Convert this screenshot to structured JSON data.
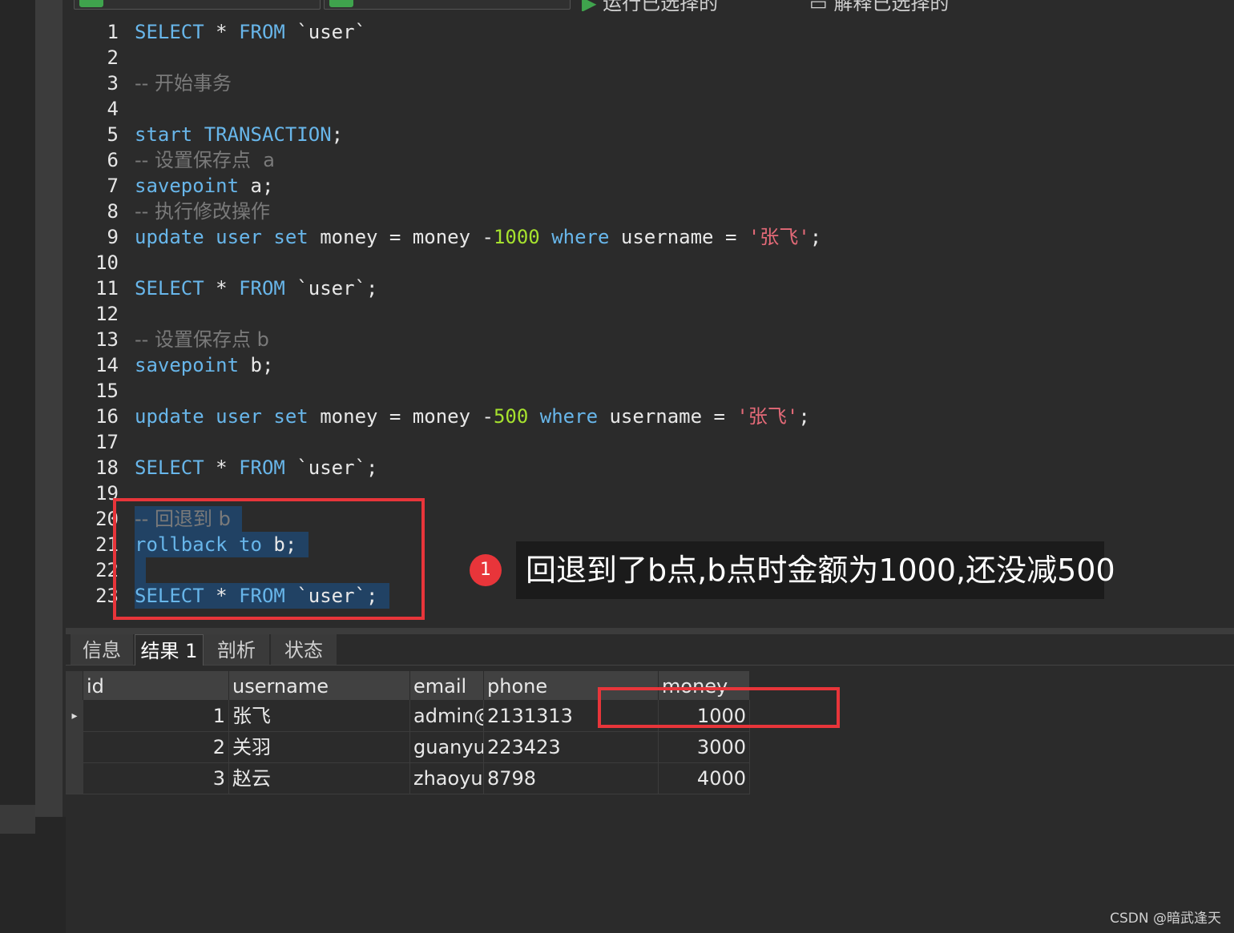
{
  "toolbar": {
    "text_left": "运行已选择的",
    "text_right": "解释已选择的",
    "accent_green": "#3fa34d"
  },
  "editor": {
    "lines": [
      {
        "n": "1",
        "tokens": [
          {
            "t": "SELECT",
            "c": "kw"
          },
          {
            "t": " * ",
            "c": "plain"
          },
          {
            "t": "FROM",
            "c": "kw"
          },
          {
            "t": " `user`",
            "c": "plain"
          }
        ]
      },
      {
        "n": "2",
        "tokens": []
      },
      {
        "n": "3",
        "tokens": [
          {
            "t": "-- 开始事务",
            "c": "cm"
          }
        ]
      },
      {
        "n": "4",
        "tokens": []
      },
      {
        "n": "5",
        "tokens": [
          {
            "t": "start",
            "c": "kw"
          },
          {
            "t": " ",
            "c": "plain"
          },
          {
            "t": "TRANSACTION",
            "c": "kw"
          },
          {
            "t": ";",
            "c": "plain"
          }
        ]
      },
      {
        "n": "6",
        "tokens": [
          {
            "t": "-- 设置保存点  a",
            "c": "cm"
          }
        ]
      },
      {
        "n": "7",
        "tokens": [
          {
            "t": "savepoint",
            "c": "kw"
          },
          {
            "t": " a;",
            "c": "plain"
          }
        ]
      },
      {
        "n": "8",
        "tokens": [
          {
            "t": "-- 执行修改操作",
            "c": "cm"
          }
        ]
      },
      {
        "n": "9",
        "tokens": [
          {
            "t": "update",
            "c": "kw"
          },
          {
            "t": " ",
            "c": "plain"
          },
          {
            "t": "user",
            "c": "kw"
          },
          {
            "t": " ",
            "c": "plain"
          },
          {
            "t": "set",
            "c": "kw"
          },
          {
            "t": " money = money -",
            "c": "plain"
          },
          {
            "t": "1000",
            "c": "num"
          },
          {
            "t": " ",
            "c": "plain"
          },
          {
            "t": "where",
            "c": "kw"
          },
          {
            "t": " username = ",
            "c": "plain"
          },
          {
            "t": "'张飞'",
            "c": "str"
          },
          {
            "t": ";",
            "c": "plain"
          }
        ]
      },
      {
        "n": "10",
        "tokens": []
      },
      {
        "n": "11",
        "tokens": [
          {
            "t": "SELECT",
            "c": "kw"
          },
          {
            "t": " * ",
            "c": "plain"
          },
          {
            "t": "FROM",
            "c": "kw"
          },
          {
            "t": " `user`;",
            "c": "plain"
          }
        ]
      },
      {
        "n": "12",
        "tokens": []
      },
      {
        "n": "13",
        "tokens": [
          {
            "t": "-- 设置保存点 b",
            "c": "cm"
          }
        ]
      },
      {
        "n": "14",
        "tokens": [
          {
            "t": "savepoint",
            "c": "kw"
          },
          {
            "t": " b;",
            "c": "plain"
          }
        ]
      },
      {
        "n": "15",
        "tokens": []
      },
      {
        "n": "16",
        "tokens": [
          {
            "t": "update",
            "c": "kw"
          },
          {
            "t": " ",
            "c": "plain"
          },
          {
            "t": "user",
            "c": "kw"
          },
          {
            "t": " ",
            "c": "plain"
          },
          {
            "t": "set",
            "c": "kw"
          },
          {
            "t": " money = money -",
            "c": "plain"
          },
          {
            "t": "500",
            "c": "num"
          },
          {
            "t": " ",
            "c": "plain"
          },
          {
            "t": "where",
            "c": "kw"
          },
          {
            "t": " username = ",
            "c": "plain"
          },
          {
            "t": "'张飞'",
            "c": "str"
          },
          {
            "t": ";",
            "c": "plain"
          }
        ]
      },
      {
        "n": "17",
        "tokens": []
      },
      {
        "n": "18",
        "tokens": [
          {
            "t": "SELECT",
            "c": "kw"
          },
          {
            "t": " * ",
            "c": "plain"
          },
          {
            "t": "FROM",
            "c": "kw"
          },
          {
            "t": " `user`;",
            "c": "plain"
          }
        ]
      },
      {
        "n": "19",
        "tokens": []
      },
      {
        "n": "20",
        "hl": true,
        "tokens": [
          {
            "t": "-- 回退到 b",
            "c": "cm"
          }
        ]
      },
      {
        "n": "21",
        "hl": true,
        "tokens": [
          {
            "t": "rollback",
            "c": "kw"
          },
          {
            "t": " ",
            "c": "plain"
          },
          {
            "t": "to",
            "c": "kw"
          },
          {
            "t": " b;",
            "c": "plain"
          }
        ]
      },
      {
        "n": "22",
        "hl": true,
        "tokens": []
      },
      {
        "n": "23",
        "hl": true,
        "tokens": [
          {
            "t": "SELECT",
            "c": "kw"
          },
          {
            "t": " * ",
            "c": "plain"
          },
          {
            "t": "FROM",
            "c": "kw"
          },
          {
            "t": " `user`;",
            "c": "plain"
          }
        ]
      }
    ]
  },
  "callout": {
    "number": "1",
    "text": "回退到了b点,b点时金额为1000,还没减500"
  },
  "tabs": [
    "信息",
    "结果 1",
    "剖析",
    "状态"
  ],
  "active_tab": "结果 1",
  "results": {
    "columns": [
      "id",
      "username",
      "email",
      "phone",
      "money"
    ],
    "rows": [
      [
        "1",
        "张飞",
        "admin@",
        "2131313",
        "1000"
      ],
      [
        "2",
        "关羽",
        "guanyu",
        "223423",
        "3000"
      ],
      [
        "3",
        "赵云",
        "zhaoyun",
        "8798",
        "4000"
      ]
    ],
    "current_row_marker": "▸"
  },
  "watermark": "CSDN @暗武逢天",
  "colors": {
    "keyword": "#68b6ea",
    "comment": "#7a7a7a",
    "number": "#a6e22e",
    "string": "#e46a78",
    "highlight_box": "#e8353a",
    "selection": "#214264"
  }
}
